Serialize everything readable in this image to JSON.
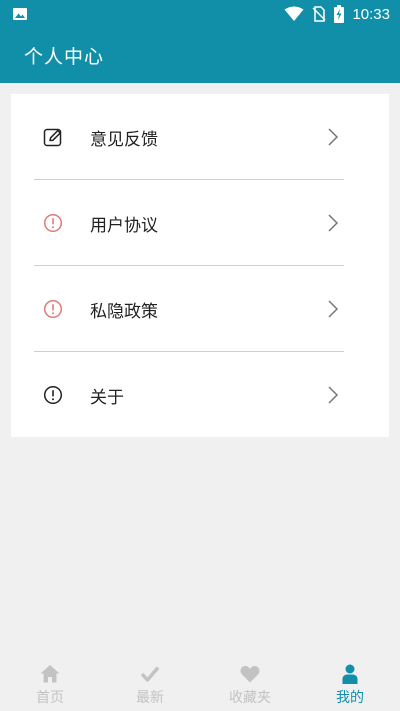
{
  "status_bar": {
    "time": "10:33"
  },
  "header": {
    "title": "个人中心"
  },
  "menu": [
    {
      "label": "意见反馈",
      "icon": "edit-icon"
    },
    {
      "label": "用户协议",
      "icon": "alert-circle-icon"
    },
    {
      "label": "私隐政策",
      "icon": "alert-circle-icon"
    },
    {
      "label": "关于",
      "icon": "alert-circle-icon"
    }
  ],
  "tabs": [
    {
      "label": "首页",
      "icon": "home-icon",
      "active": false
    },
    {
      "label": "最新",
      "icon": "check-icon",
      "active": false
    },
    {
      "label": "收藏夹",
      "icon": "heart-icon",
      "active": false
    },
    {
      "label": "我的",
      "icon": "person-icon",
      "active": true
    }
  ],
  "colors": {
    "primary": "#128fa8",
    "alert": "#e07a7a",
    "inactive": "#c3c3c3"
  }
}
